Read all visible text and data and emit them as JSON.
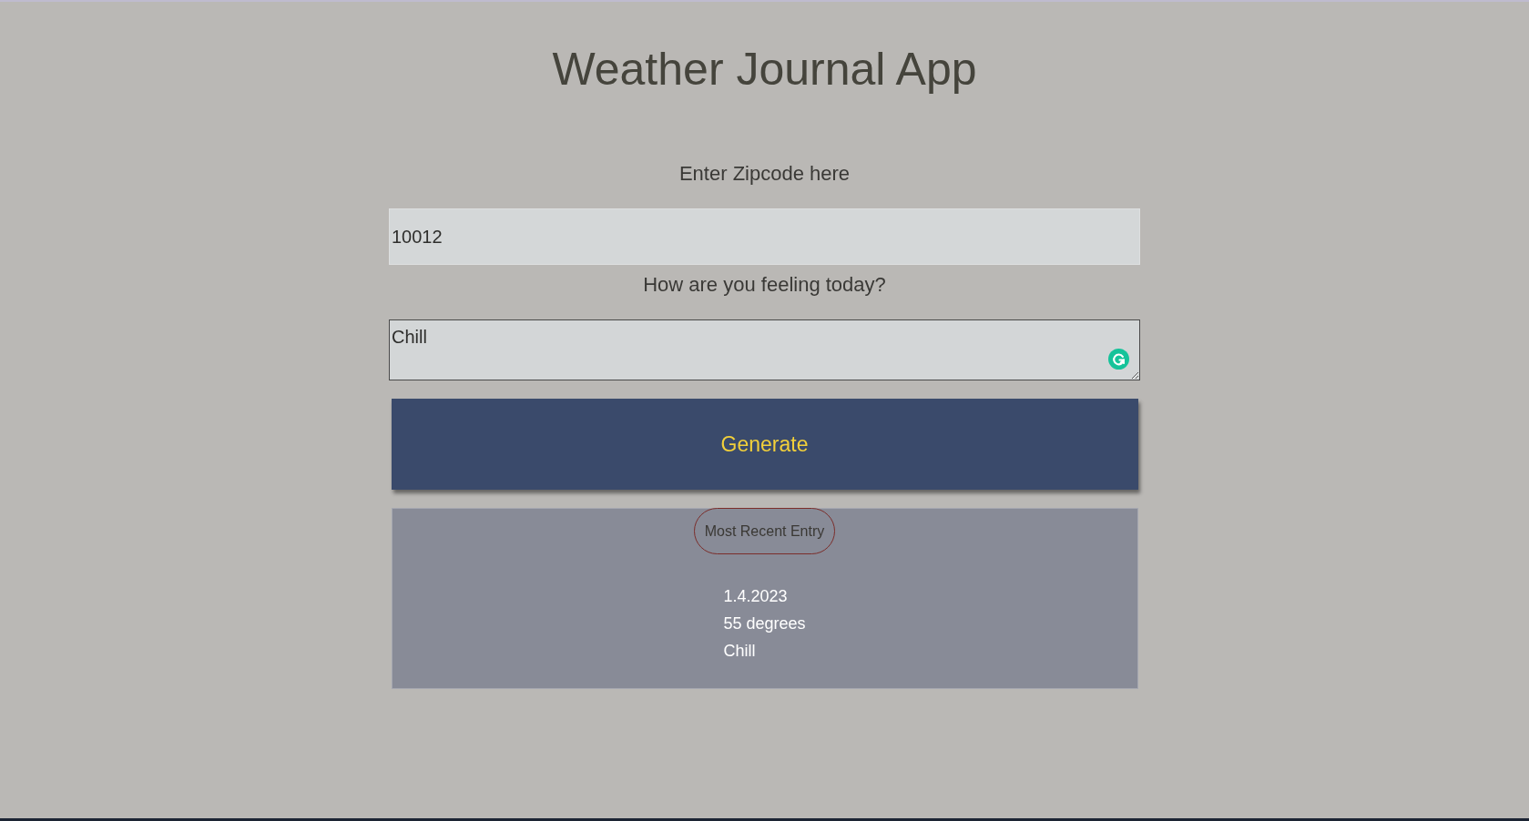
{
  "title": "Weather Journal App",
  "zip": {
    "label": "Enter Zipcode here",
    "value": "10012"
  },
  "feelings": {
    "label": "How are you feeling today?",
    "value": "Chill"
  },
  "generate_button": {
    "label": "Generate"
  },
  "entry": {
    "heading": "Most Recent Entry",
    "date": "1.4.2023",
    "temp": "55 degrees",
    "content": "Chill"
  }
}
